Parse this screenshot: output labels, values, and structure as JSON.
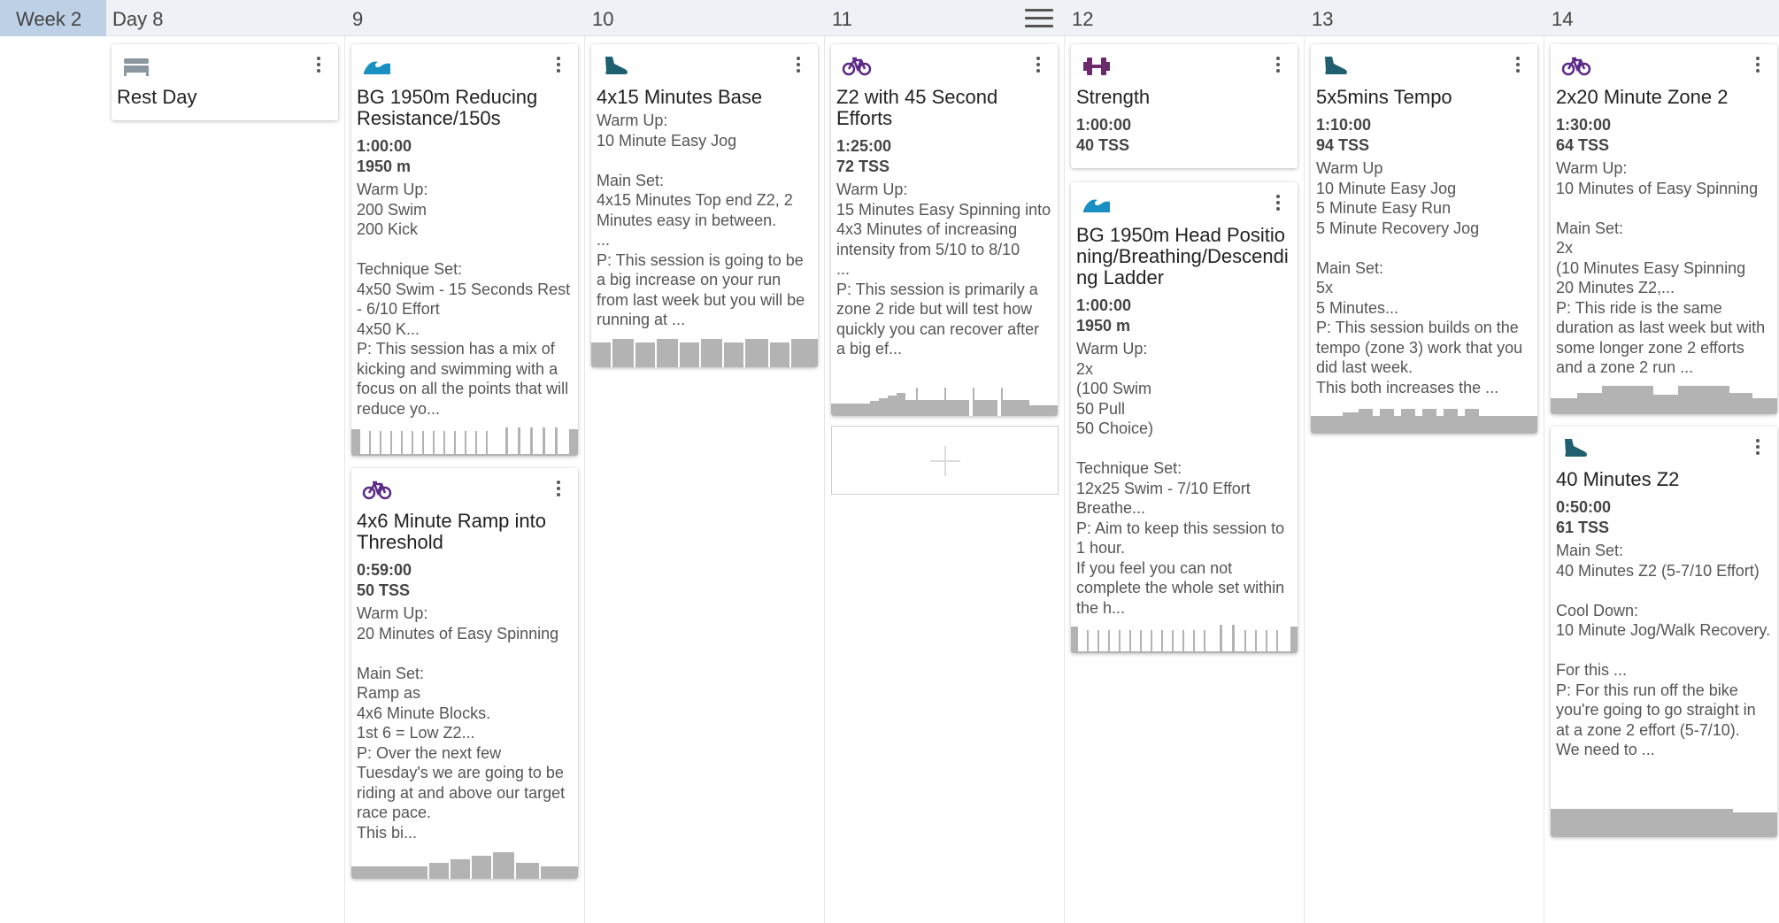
{
  "header": {
    "week": "Week 2",
    "days": [
      "Day 8",
      "9",
      "10",
      "11",
      "12",
      "13",
      "14"
    ]
  },
  "colors": {
    "swim": "#1a8fc1",
    "bike": "#5b2a86",
    "run": "#1f5f6f",
    "strength": "#6b2a6b",
    "rest": "#8a979e",
    "graph": "#b3b3b3"
  },
  "add_workout": {
    "icon": "plus-icon"
  },
  "workouts": {
    "rest_day": {
      "icon": "bed-icon",
      "title": "Rest Day"
    },
    "swim_9": {
      "icon": "swim-icon",
      "title": "BG 1950m Reducing Resistance/150s",
      "duration": "1:00:00",
      "metric": "1950 m",
      "desc": "Warm Up:\n200 Swim\n200 Kick\n\nTechnique Set:\n4x50 Swim - 15 Seconds Rest - 6/10 Effort\n4x50 K...\nP: This session has a mix of kicking and swimming with a focus on all the points that will reduce yo..."
    },
    "bike_9": {
      "icon": "bike-icon",
      "title": "4x6 Minute Ramp into Threshold",
      "duration": "0:59:00",
      "metric": "50 TSS",
      "desc": "Warm Up:\n20 Minutes of Easy Spinning\n\nMain Set:\nRamp as\n4x6 Minute Blocks.\n1st 6 = Low Z2...\nP: Over the next few Tuesday's we are going to be riding at and above our target race pace.\nThis bi..."
    },
    "run_10": {
      "icon": "run-shoe-icon",
      "title": "4x15 Minutes Base",
      "desc": "Warm Up:\n10 Minute Easy Jog\n\nMain Set:\n4x15 Minutes Top end Z2, 2 Minutes easy in between.\n...\nP: This session is going to be a big increase on your run from last week but you will be running at ..."
    },
    "bike_11": {
      "icon": "bike-icon",
      "title": "Z2 with 45 Second Efforts",
      "duration": "1:25:00",
      "metric": "72 TSS",
      "desc": "Warm Up:\n15 Minutes Easy Spinning into\n4x3 Minutes of increasing intensity from 5/10 to 8/10\n...\nP: This session is primarily a zone 2 ride but will test how quickly  you can recover after a big ef..."
    },
    "strength_12": {
      "icon": "dumbbell-icon",
      "title": "Strength",
      "duration": "1:00:00",
      "metric": "40 TSS"
    },
    "swim_12": {
      "icon": "swim-icon",
      "title": "BG 1950m Head Positioning/Breathing/Descending Ladder",
      "duration": "1:00:00",
      "metric": "1950 m",
      "desc": "Warm Up:\n2x\n(100 Swim\n50 Pull\n50 Choice)\n\nTechnique Set:\n12x25 Swim - 7/10 Effort Breathe...\nP: Aim to keep this session to 1 hour.\nIf you feel you can not complete the whole set within the h..."
    },
    "run_13": {
      "icon": "run-shoe-icon",
      "title": "5x5mins Tempo",
      "duration": "1:10:00",
      "metric": "94 TSS",
      "desc": "Warm Up\n10 Minute Easy Jog\n5 Minute Easy Run\n5 Minute Recovery Jog\n\nMain Set:\n5x\n5 Minutes...\nP: This session builds on the tempo (zone 3) work that you did last week.\nThis both increases the ..."
    },
    "bike_14": {
      "icon": "bike-icon",
      "title": "2x20 Minute Zone 2",
      "duration": "1:30:00",
      "metric": "64 TSS",
      "desc": "Warm Up:\n10 Minutes of Easy Spinning\n\nMain Set:\n2x\n(10 Minutes Easy Spinning\n20 Minutes Z2,...\nP: This ride is the same duration as last week but with some longer zone 2 efforts and a zone 2 run ..."
    },
    "run_14": {
      "icon": "run-shoe-icon",
      "title": "40 Minutes Z2",
      "duration": "0:50:00",
      "metric": "61 TSS",
      "desc": "Main Set:\n40 Minutes Z2 (5-7/10 Effort)\n\nCool Down:\n10 Minute Jog/Walk Recovery.\n\nFor this ...\nP: For this run off the bike you're going to go straight in at a zone 2 effort (5-7/10).\nWe need to ..."
    }
  }
}
